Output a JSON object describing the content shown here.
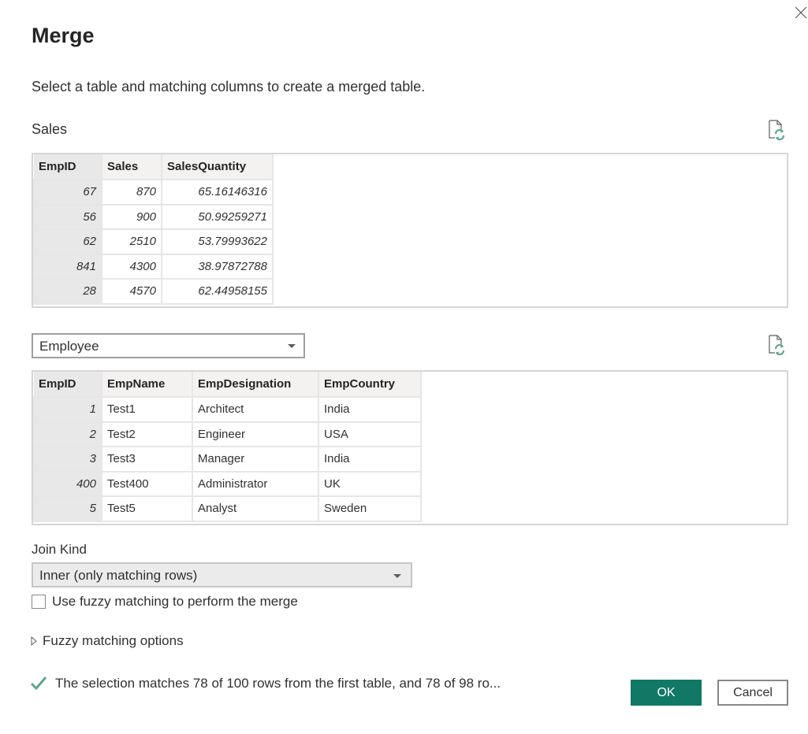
{
  "dialog": {
    "title": "Merge",
    "subtitle": "Select a table and matching columns to create a merged table."
  },
  "first_table": {
    "name": "Sales",
    "columns": [
      "EmpID",
      "Sales",
      "SalesQuantity"
    ],
    "selected_column": "EmpID",
    "rows": [
      [
        "67",
        "870",
        "65.16146316"
      ],
      [
        "56",
        "900",
        "50.99259271"
      ],
      [
        "62",
        "2510",
        "53.79993622"
      ],
      [
        "841",
        "4300",
        "38.97872788"
      ],
      [
        "28",
        "4570",
        "62.44958155"
      ]
    ]
  },
  "second_table": {
    "selected": "Employee",
    "columns": [
      "EmpID",
      "EmpName",
      "EmpDesignation",
      "EmpCountry"
    ],
    "selected_column": "EmpID",
    "rows": [
      [
        "1",
        "Test1",
        "Architect",
        "India"
      ],
      [
        "2",
        "Test2",
        "Engineer",
        "USA"
      ],
      [
        "3",
        "Test3",
        "Manager",
        "India"
      ],
      [
        "400",
        "Test400",
        "Administrator",
        "UK"
      ],
      [
        "5",
        "Test5",
        "Analyst",
        "Sweden"
      ]
    ]
  },
  "join": {
    "label": "Join Kind",
    "selected": "Inner (only matching rows)"
  },
  "fuzzy": {
    "checkbox_label": "Use fuzzy matching to perform the merge",
    "checked": false,
    "options_label": "Fuzzy matching options"
  },
  "status": {
    "icon": "checkmark-icon",
    "message": "The selection matches 78 of 100 rows from the first table, and 78 of 98 ro..."
  },
  "buttons": {
    "ok": "OK",
    "cancel": "Cancel"
  },
  "icons": {
    "close": "close-icon",
    "refresh": "refresh-preview-icon"
  },
  "colors": {
    "primary": "#117865",
    "check": "#5fa58c",
    "selected_column": "#e8e8e8"
  }
}
